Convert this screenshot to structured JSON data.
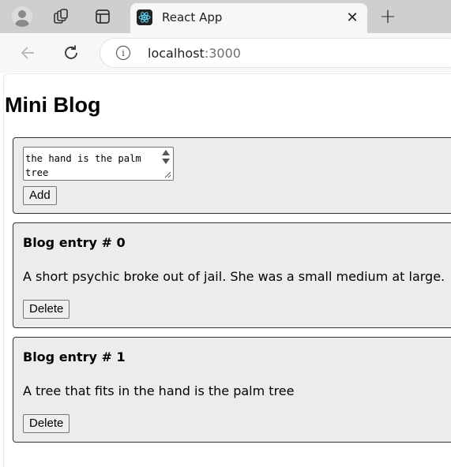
{
  "browser": {
    "tab": {
      "title": "React App",
      "close_glyph": "✕"
    },
    "new_tab_glyph": "+",
    "address": {
      "host": "localhost",
      "port": ":3000"
    }
  },
  "page": {
    "title": "Mini Blog",
    "composer": {
      "textarea_value": "the hand is the palm tree",
      "add_label": "Add"
    },
    "entries": [
      {
        "title": "Blog entry # 0",
        "text": "A short psychic broke out of jail. She was a small medium at large.",
        "delete_label": "Delete"
      },
      {
        "title": "Blog entry # 1",
        "text": "A tree that fits in the hand is the palm tree",
        "delete_label": "Delete"
      }
    ]
  },
  "colors": {
    "tabbar_bg": "#cfcfcf",
    "toolbar_bg": "#f7f7f7",
    "card_bg": "#ececec",
    "react_logo": "#61dafb"
  },
  "icons": [
    "profile-avatar-icon",
    "workspaces-icon",
    "tab-actions-icon",
    "react-logo-icon",
    "close-icon",
    "plus-icon",
    "back-arrow-icon",
    "reload-icon",
    "info-icon"
  ]
}
